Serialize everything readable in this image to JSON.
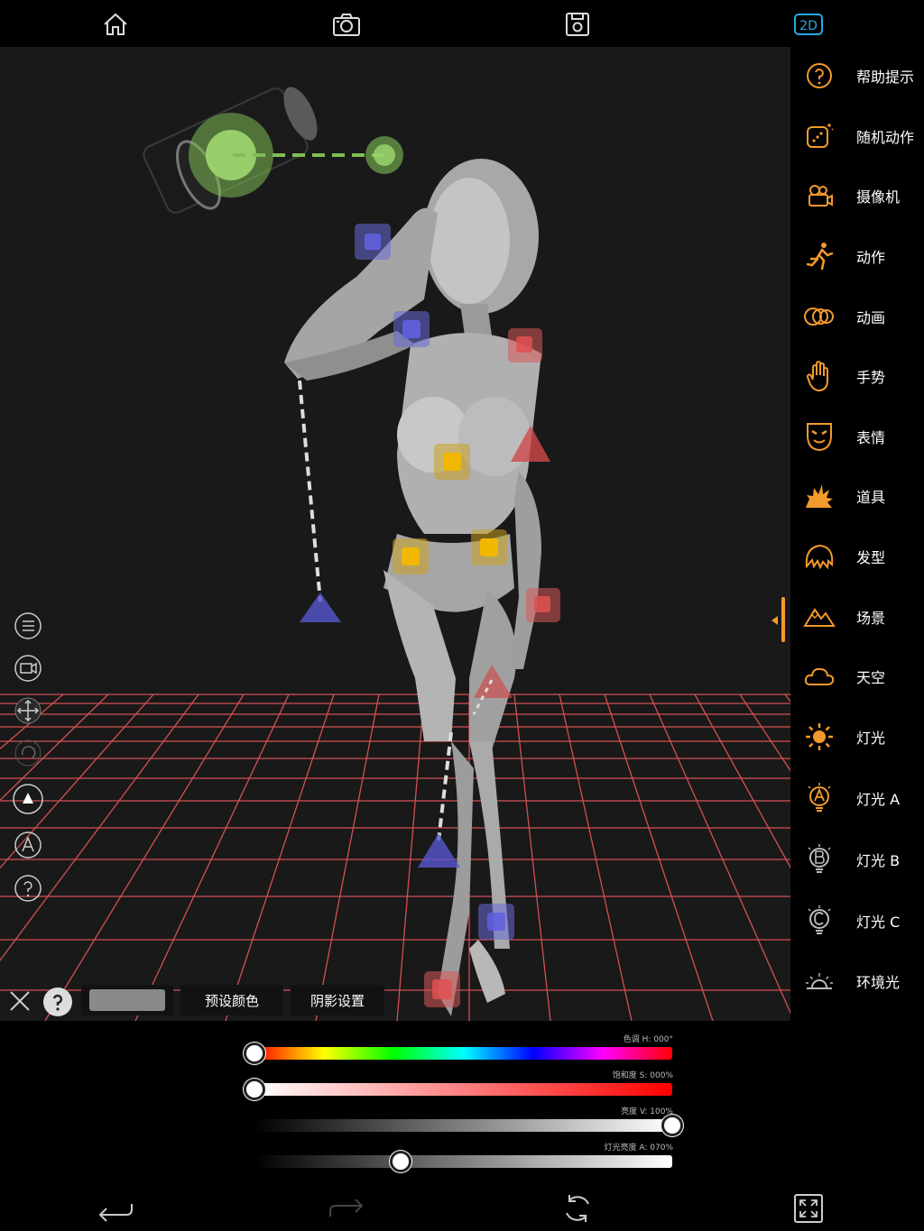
{
  "top_toolbar": {
    "icons": [
      "home-icon",
      "camera-icon",
      "save-icon",
      "2d-mode-icon"
    ],
    "mode_label": "2D"
  },
  "sidebar": {
    "items": [
      {
        "label": "帮助提示",
        "icon": "help-icon"
      },
      {
        "label": "随机动作",
        "icon": "dice-icon"
      },
      {
        "label": "摄像机",
        "icon": "video-camera-icon"
      },
      {
        "label": "动作",
        "icon": "running-figure-icon"
      },
      {
        "label": "动画",
        "icon": "animation-rings-icon"
      },
      {
        "label": "手势",
        "icon": "hand-icon"
      },
      {
        "label": "表情",
        "icon": "face-mask-icon"
      },
      {
        "label": "道具",
        "icon": "burst-icon"
      },
      {
        "label": "发型",
        "icon": "hair-icon"
      },
      {
        "label": "场景",
        "icon": "mountain-icon"
      },
      {
        "label": "天空",
        "icon": "cloud-icon"
      },
      {
        "label": "灯光",
        "icon": "sun-icon"
      },
      {
        "label": "灯光 A",
        "icon": "bulb-a-icon"
      },
      {
        "label": "灯光 B",
        "icon": "bulb-b-icon"
      },
      {
        "label": "灯光 C",
        "icon": "bulb-c-icon"
      },
      {
        "label": "环境光",
        "icon": "sunrise-icon"
      }
    ]
  },
  "left_tools": [
    "list-icon",
    "camera-view-icon",
    "move-arrows-icon",
    "rotate-icon",
    "triangle-icon",
    "letter-a-icon",
    "help-icon"
  ],
  "light_bar": {
    "color_swatch": "#8a8a8a",
    "preset_color_label": "预设颜色",
    "shadow_settings_label": "阴影设置"
  },
  "sliders": {
    "hue": {
      "label": "色调 H: 000°",
      "value": 0.0
    },
    "saturation": {
      "label": "饱和度 S: 000%",
      "value": 0.0
    },
    "value": {
      "label": "亮度 V: 100%",
      "value": 1.0
    },
    "alpha": {
      "label": "灯光亮度 A: 070%",
      "value": 0.35
    }
  },
  "colors": {
    "accent_orange": "#f39a2c",
    "accent_blue": "#29a9e0",
    "grid_red": "#e8565a",
    "viewport_bg": "#191919"
  },
  "bottom_bar": [
    "undo-icon",
    "redo-icon",
    "reset-rotate-icon",
    "fullscreen-icon"
  ]
}
